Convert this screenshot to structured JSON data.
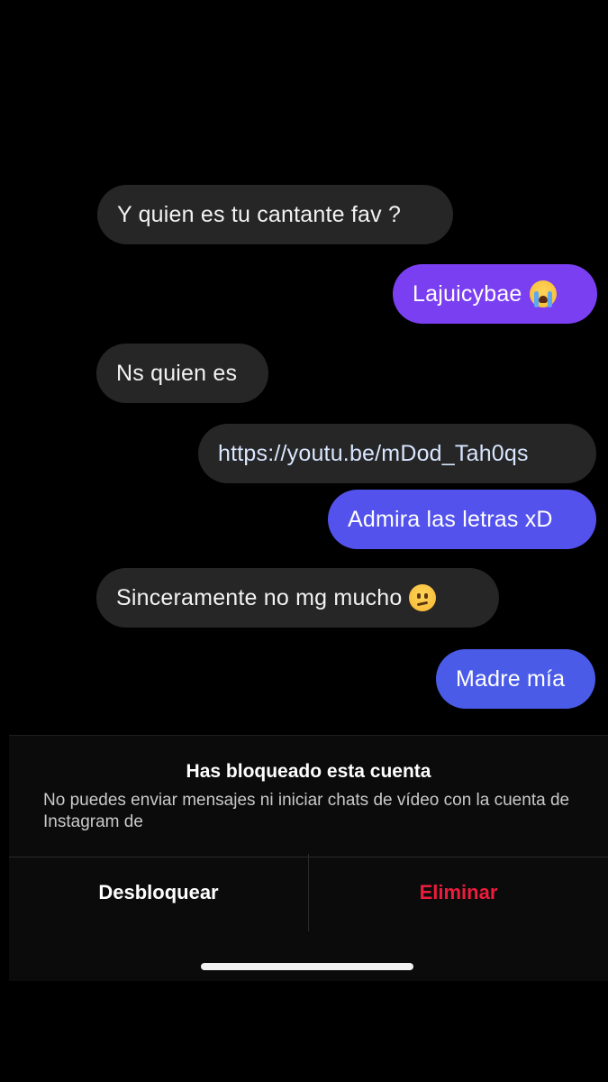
{
  "conversation": {
    "messages": [
      {
        "text": "Y quien es tu cantante fav ?",
        "sender": "other"
      },
      {
        "text": "Lajuicybae",
        "sender": "me",
        "emoji": "loudly-crying-face-emoji"
      },
      {
        "text": "Ns quien es",
        "sender": "other"
      },
      {
        "text": "https://youtu.be/mDod_Tah0qs",
        "sender": "me"
      },
      {
        "text": "Admira las letras xD",
        "sender": "me"
      },
      {
        "text": "Sinceramente no mg mucho",
        "sender": "other",
        "emoji": "confused-face-emoji"
      },
      {
        "text": "Madre mía",
        "sender": "me"
      }
    ]
  },
  "block_notice": {
    "title": "Has bloqueado esta cuenta",
    "description": "No puedes enviar mensajes ni iniciar chats de vídeo con la cuenta de Instagram de"
  },
  "actions": {
    "unblock_label": "Desbloquear",
    "delete_label": "Eliminar"
  },
  "colors": {
    "background": "#000000",
    "incoming_bubble": "#262626",
    "outgoing_purple": "#7b3ff2",
    "outgoing_indigo": "#5352ec",
    "outgoing_blue": "#4a5be8",
    "delete_red": "#ed1c3c"
  }
}
